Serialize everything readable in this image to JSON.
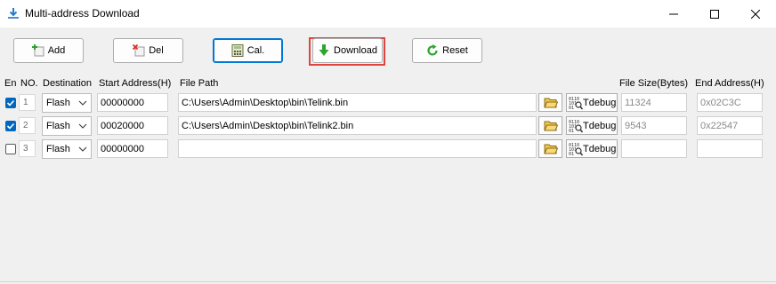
{
  "window": {
    "title": "Multi-address Download",
    "minimize_icon": "minimize-icon",
    "maximize_icon": "maximize-icon",
    "close_icon": "close-icon"
  },
  "toolbar": {
    "add_label": "Add",
    "del_label": "Del",
    "cal_label": "Cal.",
    "download_label": "Download",
    "reset_label": "Reset",
    "download_highlight_color": "#e0443e"
  },
  "table": {
    "headers": {
      "en": "En",
      "no": "NO.",
      "destination": "Destination",
      "start_address": "Start Address(H)",
      "file_path": "File Path",
      "file_size": "File Size(Bytes)",
      "end_address": "End Address(H)"
    },
    "tdebug_label": "Tdebug",
    "rows": [
      {
        "checked": true,
        "no": "1",
        "destination": "Flash",
        "start_address": "00000000",
        "file_path": "C:\\Users\\Admin\\Desktop\\bin\\Telink.bin",
        "file_size": "11324",
        "end_address": "0x02C3C"
      },
      {
        "checked": true,
        "no": "2",
        "destination": "Flash",
        "start_address": "00020000",
        "file_path": "C:\\Users\\Admin\\Desktop\\bin\\Telink2.bin",
        "file_size": "9543",
        "end_address": "0x22547"
      },
      {
        "checked": false,
        "no": "3",
        "destination": "Flash",
        "start_address": "00000000",
        "file_path": "",
        "file_size": "",
        "end_address": ""
      }
    ]
  },
  "colors": {
    "checkbox_checked": "#0067c0",
    "accent": "#0067c0"
  }
}
